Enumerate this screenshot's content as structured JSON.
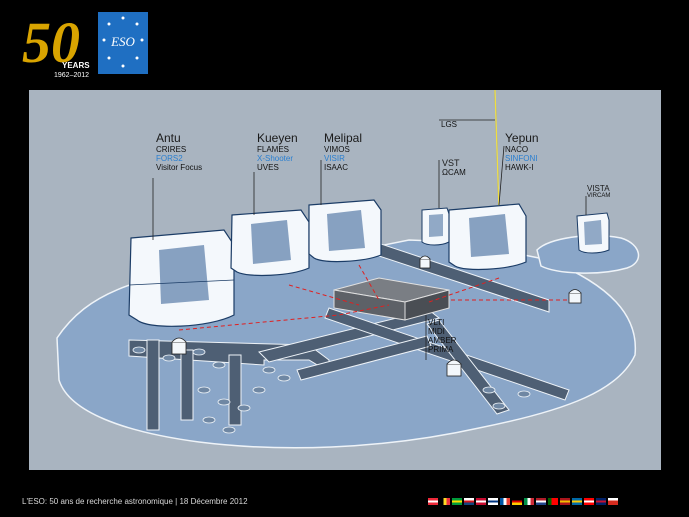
{
  "logo": {
    "number": "50",
    "years_label": "YEARS",
    "years_range": "1962–2012",
    "org": "ESO"
  },
  "diagram": {
    "lgs_label": "LGS",
    "telescopes": [
      {
        "name": "Antu",
        "instruments": [
          {
            "text": "CRIRES",
            "highlight": false
          },
          {
            "text": "FORS2",
            "highlight": true
          },
          {
            "text": "Visitor Focus",
            "highlight": false
          }
        ]
      },
      {
        "name": "Kueyen",
        "instruments": [
          {
            "text": "FLAMES",
            "highlight": false
          },
          {
            "text": "X-Shooter",
            "highlight": true
          },
          {
            "text": "UVES",
            "highlight": false
          }
        ]
      },
      {
        "name": "Melipal",
        "instruments": [
          {
            "text": "VIMOS",
            "highlight": false
          },
          {
            "text": "VISIR",
            "highlight": true
          },
          {
            "text": "ISAAC",
            "highlight": false
          }
        ]
      },
      {
        "name": "VST",
        "instruments": [
          {
            "text": "ΩCAM",
            "highlight": false
          }
        ]
      },
      {
        "name": "Yepun",
        "instruments": [
          {
            "text": "NACO",
            "highlight": false
          },
          {
            "text": "SINFONI",
            "highlight": true
          },
          {
            "text": "HAWK-I",
            "highlight": false
          }
        ]
      },
      {
        "name": "VISTA",
        "instruments": [
          {
            "text": "VIRCAM",
            "highlight": false
          }
        ]
      }
    ],
    "vlti": {
      "name": "VLTI",
      "instruments": [
        "MIDI",
        "AMBER",
        "PRIMA"
      ]
    }
  },
  "footer": {
    "text": "L'ESO: 50 ans de recherche  astronomique | 18 Décembre 2012"
  },
  "colors": {
    "background": "#000000",
    "slide": "#a9b4c0",
    "platform": "#8aa6c8",
    "highlight": "#2a7fd0",
    "logo_gold": "#d9a400",
    "logo_blue": "#1f6fc2"
  },
  "flags": [
    {
      "name": "austria-flag",
      "c": [
        "#ed2939",
        "#ffffff",
        "#ed2939"
      ],
      "dir": "h"
    },
    {
      "name": "belgium-flag",
      "c": [
        "#000000",
        "#fdda24",
        "#ef3340"
      ],
      "dir": "v"
    },
    {
      "name": "brazil-flag",
      "c": [
        "#009c3b",
        "#ffdf00",
        "#009c3b"
      ],
      "dir": "h"
    },
    {
      "name": "czech-flag",
      "c": [
        "#ffffff",
        "#d7141a",
        "#11457e"
      ],
      "dir": "h"
    },
    {
      "name": "denmark-flag",
      "c": [
        "#c60c30",
        "#ffffff",
        "#c60c30"
      ],
      "dir": "h"
    },
    {
      "name": "finland-flag",
      "c": [
        "#ffffff",
        "#003580",
        "#ffffff"
      ],
      "dir": "h"
    },
    {
      "name": "france-flag",
      "c": [
        "#0055a4",
        "#ffffff",
        "#ef4135"
      ],
      "dir": "v"
    },
    {
      "name": "germany-flag",
      "c": [
        "#000000",
        "#dd0000",
        "#ffce00"
      ],
      "dir": "h"
    },
    {
      "name": "italy-flag",
      "c": [
        "#009246",
        "#ffffff",
        "#ce2b37"
      ],
      "dir": "v"
    },
    {
      "name": "netherlands-flag",
      "c": [
        "#ae1c28",
        "#ffffff",
        "#21468b"
      ],
      "dir": "h"
    },
    {
      "name": "portugal-flag",
      "c": [
        "#006600",
        "#ff0000",
        "#ff0000"
      ],
      "dir": "v"
    },
    {
      "name": "spain-flag",
      "c": [
        "#aa151b",
        "#f1bf00",
        "#aa151b"
      ],
      "dir": "h"
    },
    {
      "name": "sweden-flag",
      "c": [
        "#006aa7",
        "#fecc00",
        "#006aa7"
      ],
      "dir": "h"
    },
    {
      "name": "switzerland-flag",
      "c": [
        "#ff0000",
        "#ffffff",
        "#ff0000"
      ],
      "dir": "h"
    },
    {
      "name": "uk-flag",
      "c": [
        "#012169",
        "#c8102e",
        "#012169"
      ],
      "dir": "h"
    },
    {
      "name": "chile-flag",
      "c": [
        "#ffffff",
        "#d52b1e",
        "#d52b1e"
      ],
      "dir": "h"
    }
  ]
}
